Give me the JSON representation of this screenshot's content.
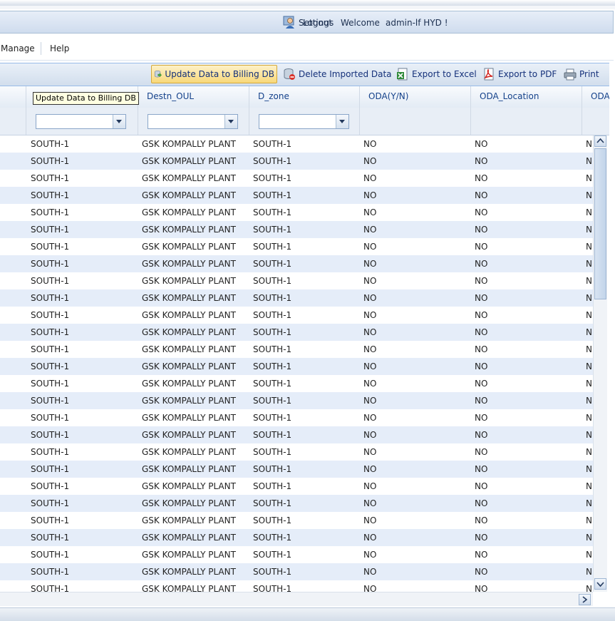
{
  "header": {
    "overlap_a": "Settings",
    "overlap_b": "Logout",
    "welcome": "Welcome",
    "user": "admin-lf HYD !"
  },
  "menu": {
    "manage": "Manage",
    "help": "Help"
  },
  "toolbar": {
    "update": "Update Data to Billing DB",
    "delete": "Delete Imported Data",
    "excel": "Export to Excel",
    "pdf": "Export to PDF",
    "print": "Print"
  },
  "tooltip": "Update Data to Billing DB",
  "columns": [
    "Destn_OUL",
    "D_zone",
    "ODA(Y/N)",
    "ODA_Location",
    "ODA"
  ],
  "rows": [
    [
      "SOUTH-1",
      "GSK KOMPALLY PLANT",
      "SOUTH-1",
      "NO",
      "NO",
      "N"
    ],
    [
      "SOUTH-1",
      "GSK KOMPALLY PLANT",
      "SOUTH-1",
      "NO",
      "NO",
      "N"
    ],
    [
      "SOUTH-1",
      "GSK KOMPALLY PLANT",
      "SOUTH-1",
      "NO",
      "NO",
      "N"
    ],
    [
      "SOUTH-1",
      "GSK KOMPALLY PLANT",
      "SOUTH-1",
      "NO",
      "NO",
      "N"
    ],
    [
      "SOUTH-1",
      "GSK KOMPALLY PLANT",
      "SOUTH-1",
      "NO",
      "NO",
      "N"
    ],
    [
      "SOUTH-1",
      "GSK KOMPALLY PLANT",
      "SOUTH-1",
      "NO",
      "NO",
      "N"
    ],
    [
      "SOUTH-1",
      "GSK KOMPALLY PLANT",
      "SOUTH-1",
      "NO",
      "NO",
      "N"
    ],
    [
      "SOUTH-1",
      "GSK KOMPALLY PLANT",
      "SOUTH-1",
      "NO",
      "NO",
      "N"
    ],
    [
      "SOUTH-1",
      "GSK KOMPALLY PLANT",
      "SOUTH-1",
      "NO",
      "NO",
      "N"
    ],
    [
      "SOUTH-1",
      "GSK KOMPALLY PLANT",
      "SOUTH-1",
      "NO",
      "NO",
      "N"
    ],
    [
      "SOUTH-1",
      "GSK KOMPALLY PLANT",
      "SOUTH-1",
      "NO",
      "NO",
      "N"
    ],
    [
      "SOUTH-1",
      "GSK KOMPALLY PLANT",
      "SOUTH-1",
      "NO",
      "NO",
      "N"
    ],
    [
      "SOUTH-1",
      "GSK KOMPALLY PLANT",
      "SOUTH-1",
      "NO",
      "NO",
      "N"
    ],
    [
      "SOUTH-1",
      "GSK KOMPALLY PLANT",
      "SOUTH-1",
      "NO",
      "NO",
      "N"
    ],
    [
      "SOUTH-1",
      "GSK KOMPALLY PLANT",
      "SOUTH-1",
      "NO",
      "NO",
      "N"
    ],
    [
      "SOUTH-1",
      "GSK KOMPALLY PLANT",
      "SOUTH-1",
      "NO",
      "NO",
      "N"
    ],
    [
      "SOUTH-1",
      "GSK KOMPALLY PLANT",
      "SOUTH-1",
      "NO",
      "NO",
      "N"
    ],
    [
      "SOUTH-1",
      "GSK KOMPALLY PLANT",
      "SOUTH-1",
      "NO",
      "NO",
      "N"
    ],
    [
      "SOUTH-1",
      "GSK KOMPALLY PLANT",
      "SOUTH-1",
      "NO",
      "NO",
      "N"
    ],
    [
      "SOUTH-1",
      "GSK KOMPALLY PLANT",
      "SOUTH-1",
      "NO",
      "NO",
      "N"
    ],
    [
      "SOUTH-1",
      "GSK KOMPALLY PLANT",
      "SOUTH-1",
      "NO",
      "NO",
      "N"
    ],
    [
      "SOUTH-1",
      "GSK KOMPALLY PLANT",
      "SOUTH-1",
      "NO",
      "NO",
      "N"
    ],
    [
      "SOUTH-1",
      "GSK KOMPALLY PLANT",
      "SOUTH-1",
      "NO",
      "NO",
      "N"
    ],
    [
      "SOUTH-1",
      "GSK KOMPALLY PLANT",
      "SOUTH-1",
      "NO",
      "NO",
      "N"
    ],
    [
      "SOUTH-1",
      "GSK KOMPALLY PLANT",
      "SOUTH-1",
      "NO",
      "NO",
      "N"
    ],
    [
      "SOUTH-1",
      "GSK KOMPALLY PLANT",
      "SOUTH-1",
      "NO",
      "NO",
      "N"
    ],
    [
      "SOUTH-1",
      "GSK KOMPALLY PLANT",
      "SOUTH-1",
      "NO",
      "NO",
      "N"
    ]
  ],
  "colors": {
    "header_text": "#15428b",
    "row_alt": "#e5edf9",
    "toolbar_active": "#f8d87a"
  }
}
